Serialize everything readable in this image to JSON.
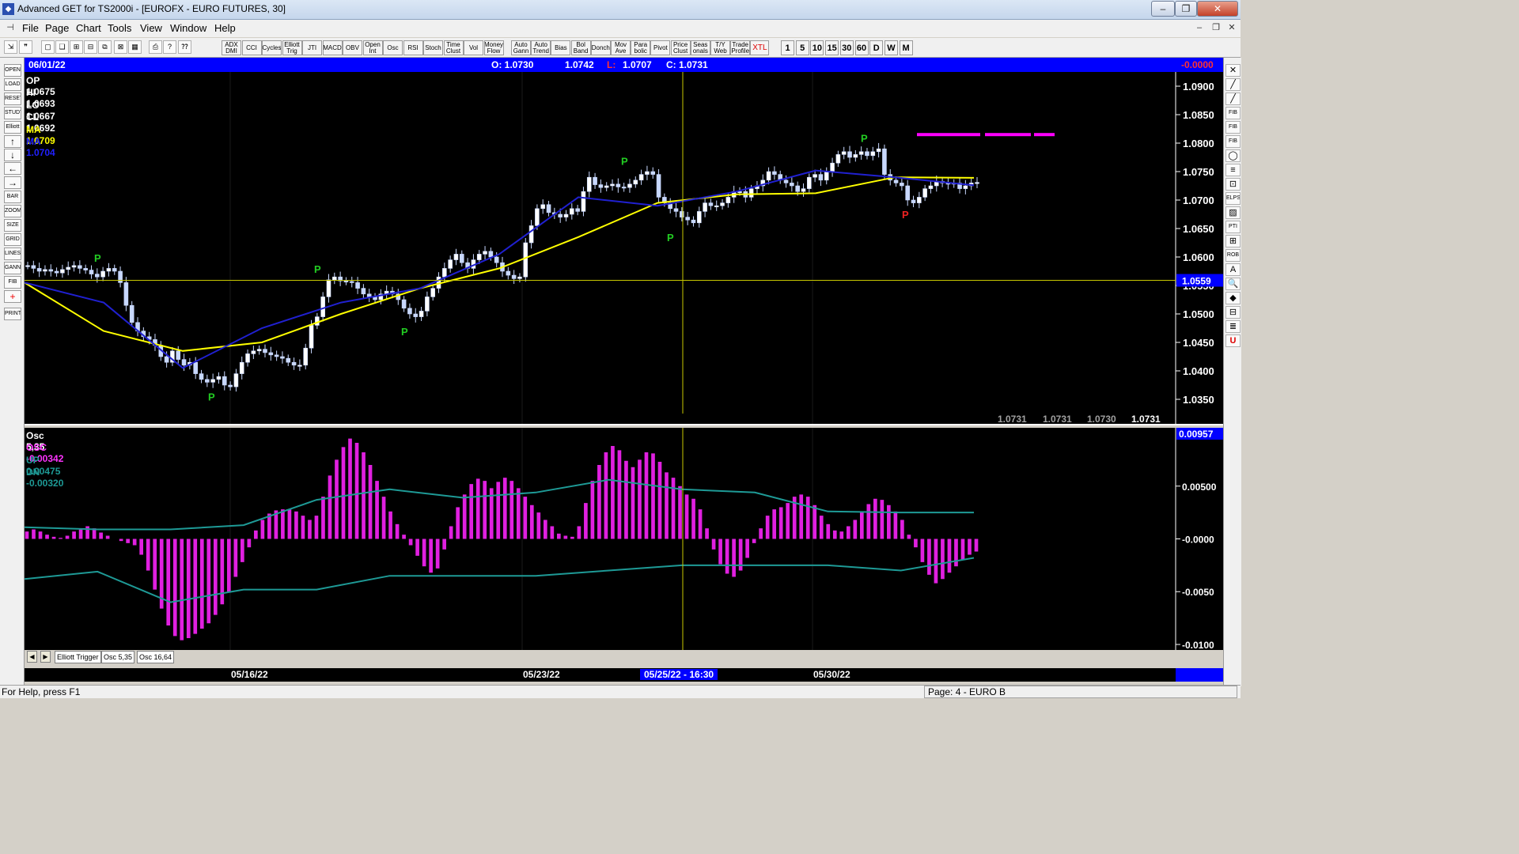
{
  "window": {
    "title": "Advanced GET for TS2000i - [EUROFX - EURO FUTURES, 30]",
    "buttons": {
      "minimize": "–",
      "restore": "❐",
      "close": "✕"
    }
  },
  "menu": [
    "File",
    "Page",
    "Chart",
    "Tools",
    "View",
    "Window",
    "Help"
  ],
  "toolbar": {
    "studies": [
      "ADX DMI",
      "CCI",
      "Cycles",
      "Elliott Trig",
      "JTI",
      "MACD",
      "OBV",
      "Open Int",
      "Osc",
      "RSI",
      "Stoch",
      "Time Clust",
      "Vol",
      "Money Flow"
    ],
    "tools": [
      "Auto Gann",
      "Auto Trend",
      "Bias",
      "Bol Band",
      "Donch",
      "Mov Ave",
      "Para bolic",
      "Pivot",
      "Price Clust",
      "Seas onals",
      "T/Y Web",
      "Trade Profile",
      "XTL"
    ],
    "intervals": [
      "1",
      "5",
      "10",
      "15",
      "30",
      "60",
      "D",
      "W",
      "M"
    ]
  },
  "left_tools": [
    "OPEN",
    "LOAD",
    "RESET",
    "STUDY",
    "Elliott",
    "↑",
    "↓",
    "←",
    "→",
    "BAR",
    "ZOOM",
    "SIZE",
    "GRID",
    "LINES",
    "GANN",
    "FIB",
    "+",
    "PRINT"
  ],
  "right_tools": [
    "✕",
    "╱",
    "╱",
    "FIB RET",
    "FIB EXT",
    "FIB TIME",
    "◯",
    "≡",
    "⊡",
    "ELPS",
    "▨",
    "PTI",
    "⊞",
    "ROB",
    "A",
    "🔍",
    "◆",
    "⊟",
    "≣",
    "U"
  ],
  "info": {
    "date": "06/01/22",
    "open": "O: 1.0730",
    "high": "1.0742",
    "low_label": "L:",
    "low": "1.0707",
    "close": "C: 1.0731",
    "change": "-0.0000"
  },
  "price_panel": {
    "labels": [
      {
        "text": "OP  1.0675",
        "color": "#ffffff"
      },
      {
        "text": "HI   1.0693",
        "color": "#ffffff"
      },
      {
        "text": "LO  1.0667",
        "color": "#ffffff"
      },
      {
        "text": "CL  1.0692",
        "color": "#ffffff"
      },
      {
        "text": "MA  1.0709",
        "color": "#ffff00"
      },
      {
        "text": "MA  1.0704",
        "color": "#2020ff"
      }
    ],
    "y_ticks": [
      "1.0900",
      "1.0850",
      "1.0800",
      "1.0750",
      "1.0700",
      "1.0650",
      "1.0600",
      "1.0550",
      "1.0500",
      "1.0450",
      "1.0400",
      "1.0350"
    ],
    "cursor_price": "1.0559",
    "bottom_values": [
      "1.0731",
      "1.0731",
      "1.0730",
      "1.0731"
    ],
    "pivot_label": "P"
  },
  "osc_panel": {
    "title": "Osc 5,35",
    "labels": [
      {
        "text": "OSC -0.00342",
        "color": "#ff33ff"
      },
      {
        "text": "UP   0.00475",
        "color": "#1e9a96"
      },
      {
        "text": "DN   -0.00320",
        "color": "#1e9a96"
      }
    ],
    "top_value": "0.00957",
    "y_ticks": [
      "0.00500",
      "-0.0000",
      "-0.0050",
      "-0.0100"
    ]
  },
  "tabs": [
    "Elliott Trigger",
    "Osc 5,35",
    "Osc 16,64"
  ],
  "x_axis": {
    "dates": [
      "05/16/22",
      "05/23/22",
      "05/30/22"
    ],
    "cursor": "05/25/22 - 16:30"
  },
  "status": {
    "help": "For Help, press F1",
    "page": "Page: 4 - EURO B"
  },
  "colors": {
    "info_bar": "#0000ff",
    "ma_fast": "#ffff00",
    "ma_slow": "#2020d0",
    "osc": "#e020e0",
    "band": "#1e9a96",
    "pivot_high": "#22cc22",
    "pivot_low": "#ee2222",
    "bars": "#c8d8ff"
  },
  "chart_data": {
    "type": "candlestick",
    "price": {
      "ylim": [
        1.0325,
        1.0925
      ],
      "y_ticks": [
        1.09,
        1.085,
        1.08,
        1.075,
        1.07,
        1.065,
        1.06,
        1.055,
        1.05,
        1.045,
        1.04,
        1.035
      ],
      "close_path": [
        1.0585,
        1.058,
        1.0575,
        1.0578,
        1.0575,
        1.0572,
        1.0578,
        1.0582,
        1.0585,
        1.058,
        1.0577,
        1.057,
        1.0565,
        1.0575,
        1.058,
        1.0575,
        1.0555,
        1.0515,
        1.0485,
        1.047,
        1.046,
        1.0455,
        1.0445,
        1.0425,
        1.0415,
        1.0435,
        1.042,
        1.041,
        1.0415,
        1.0395,
        1.0385,
        1.038,
        1.0385,
        1.039,
        1.0375,
        1.0372,
        1.0395,
        1.0415,
        1.043,
        1.0435,
        1.0438,
        1.0432,
        1.0428,
        1.0425,
        1.0422,
        1.0415,
        1.041,
        1.041,
        1.044,
        1.048,
        1.0495,
        1.053,
        1.056,
        1.0565,
        1.0558,
        1.0557,
        1.0555,
        1.0545,
        1.0535,
        1.053,
        1.0525,
        1.0535,
        1.054,
        1.0535,
        1.0525,
        1.051,
        1.05,
        1.0495,
        1.0505,
        1.053,
        1.0545,
        1.0565,
        1.058,
        1.0595,
        1.0605,
        1.059,
        1.058,
        1.0595,
        1.0605,
        1.061,
        1.06,
        1.059,
        1.0575,
        1.0568,
        1.0562,
        1.0565,
        1.0625,
        1.0655,
        1.0685,
        1.0692,
        1.0678,
        1.0675,
        1.067,
        1.0675,
        1.0685,
        1.068,
        1.0715,
        1.074,
        1.0727,
        1.0722,
        1.0725,
        1.0728,
        1.0723,
        1.0722,
        1.0728,
        1.0735,
        1.0745,
        1.075,
        1.0745,
        1.0705,
        1.0695,
        1.0685,
        1.068,
        1.067,
        1.0665,
        1.066,
        1.068,
        1.0695,
        1.069,
        1.069,
        1.0695,
        1.0705,
        1.0715,
        1.0715,
        1.0705,
        1.072,
        1.0725,
        1.0735,
        1.075,
        1.0745,
        1.0735,
        1.073,
        1.0725,
        1.0715,
        1.072,
        1.074,
        1.0745,
        1.0735,
        1.075,
        1.0765,
        1.078,
        1.0785,
        1.0775,
        1.078,
        1.0785,
        1.0778,
        1.0785,
        1.079,
        1.0745,
        1.0735,
        1.073,
        1.0725,
        1.07,
        1.0695,
        1.0705,
        1.072,
        1.0725,
        1.0733,
        1.073,
        1.0728,
        1.073,
        1.072,
        1.0725,
        1.073,
        1.0731
      ],
      "ma_fast_path": [
        1.0555,
        1.047,
        1.0435,
        1.045,
        1.05,
        1.0545,
        1.058,
        1.0635,
        1.0695,
        1.071,
        1.0712,
        1.074,
        1.0739
      ],
      "ma_slow_path": [
        1.0555,
        1.052,
        1.0405,
        1.0475,
        1.052,
        1.0545,
        1.0605,
        1.0705,
        1.069,
        1.0715,
        1.0752,
        1.074,
        1.0726
      ],
      "pivot_highs": [
        1.0585,
        1.0565,
        1.0755,
        1.0795
      ],
      "pivot_lows": [
        1.037,
        1.0485,
        1.065,
        1.069
      ],
      "cursor_value": 1.0559,
      "target_band": 1.0815
    },
    "oscillator": {
      "name": "Osc 5,35",
      "ylim": [
        -0.0103,
        0.0103
      ],
      "values": [
        0.0007,
        0.0009,
        0.0007,
        0.0004,
        0.0002,
        0.0001,
        0.0003,
        0.0007,
        0.001,
        0.0012,
        0.001,
        0.0006,
        0.0003,
        0.0,
        -0.0002,
        -0.0004,
        -0.0006,
        -0.0015,
        -0.003,
        -0.0048,
        -0.0066,
        -0.0082,
        -0.0092,
        -0.0096,
        -0.0094,
        -0.009,
        -0.0085,
        -0.008,
        -0.0072,
        -0.0062,
        -0.005,
        -0.0036,
        -0.0022,
        -0.0008,
        0.0008,
        0.0018,
        0.0024,
        0.0027,
        0.0028,
        0.0028,
        0.0026,
        0.0022,
        0.0018,
        0.0022,
        0.004,
        0.006,
        0.0075,
        0.0087,
        0.0095,
        0.0091,
        0.0082,
        0.007,
        0.0055,
        0.004,
        0.0026,
        0.0014,
        0.0004,
        -0.0006,
        -0.0016,
        -0.0026,
        -0.0032,
        -0.0028,
        -0.001,
        0.0012,
        0.003,
        0.0042,
        0.0052,
        0.0057,
        0.0055,
        0.0048,
        0.0054,
        0.0058,
        0.0055,
        0.0048,
        0.004,
        0.0032,
        0.0025,
        0.0018,
        0.0012,
        0.0005,
        0.0003,
        0.0002,
        0.0012,
        0.0034,
        0.0055,
        0.007,
        0.0082,
        0.0088,
        0.0084,
        0.0074,
        0.0068,
        0.0075,
        0.0082,
        0.0081,
        0.0073,
        0.0063,
        0.0058,
        0.005,
        0.0042,
        0.0038,
        0.0028,
        0.001,
        -0.001,
        -0.0024,
        -0.0033,
        -0.0036,
        -0.003,
        -0.0018,
        -0.0004,
        0.001,
        0.0022,
        0.0028,
        0.003,
        0.0034,
        0.004,
        0.0042,
        0.004,
        0.0032,
        0.0022,
        0.0014,
        0.0008,
        0.0007,
        0.0012,
        0.0018,
        0.0026,
        0.0033,
        0.0038,
        0.0037,
        0.0032,
        0.0026,
        0.0018,
        0.0004,
        -0.0008,
        -0.0022,
        -0.0034,
        -0.0042,
        -0.0038,
        -0.0032,
        -0.0026,
        -0.002,
        -0.0015,
        -0.0012
      ],
      "up_band_path": [
        0.0011,
        0.0009,
        0.0009,
        0.0013,
        0.0037,
        0.0047,
        0.0039,
        0.0044,
        0.0056,
        0.0047,
        0.0044,
        0.0026,
        0.0025,
        0.0025
      ],
      "dn_band_path": [
        -0.0038,
        -0.0031,
        -0.006,
        -0.0048,
        -0.0048,
        -0.0035,
        -0.0035,
        -0.0035,
        -0.003,
        -0.0025,
        -0.0025,
        -0.0025,
        -0.003,
        -0.0018
      ]
    }
  }
}
